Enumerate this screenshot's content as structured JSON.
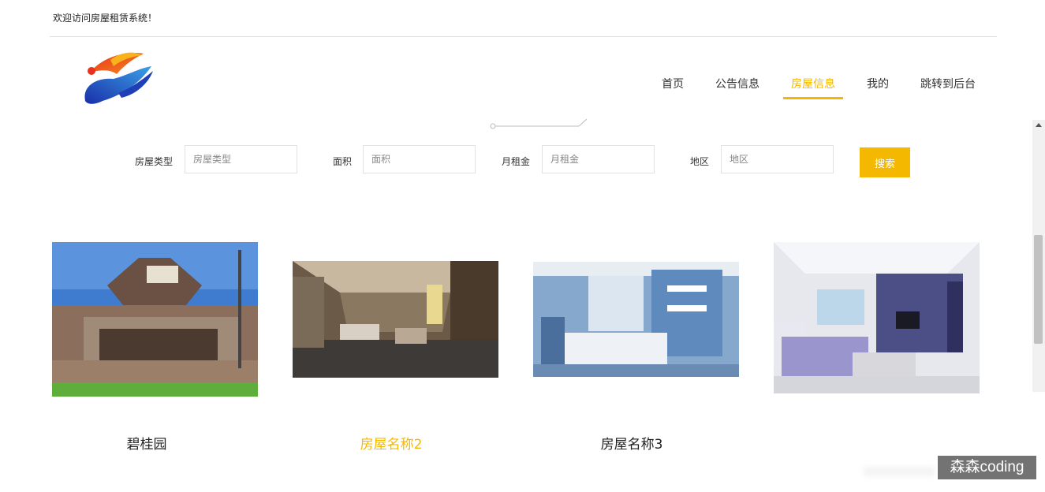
{
  "topbar": {
    "welcome": "欢迎访问房屋租赁系统！"
  },
  "nav": {
    "items": [
      {
        "label": "首页",
        "active": false
      },
      {
        "label": "公告信息",
        "active": false
      },
      {
        "label": "房屋信息",
        "active": true
      },
      {
        "label": "我的",
        "active": false
      },
      {
        "label": "跳转到后台",
        "active": false
      }
    ]
  },
  "search": {
    "fields": [
      {
        "label": "房屋类型",
        "placeholder": "房屋类型"
      },
      {
        "label": "面积",
        "placeholder": "面积"
      },
      {
        "label": "月租金",
        "placeholder": "月租金"
      },
      {
        "label": "地区",
        "placeholder": "地区"
      }
    ],
    "button": "搜索"
  },
  "houses": [
    {
      "title": "碧桂园",
      "image": "hotel-exterior",
      "highlight": false
    },
    {
      "title": "房屋名称2",
      "image": "hotel-lobby",
      "highlight": true
    },
    {
      "title": "房屋名称3",
      "image": "blue-bedroom",
      "highlight": false
    },
    {
      "title": "",
      "image": "living-room",
      "highlight": false
    }
  ],
  "watermark": "森森coding",
  "colors": {
    "accent": "#f5b800",
    "divider": "#dcdcdc"
  }
}
